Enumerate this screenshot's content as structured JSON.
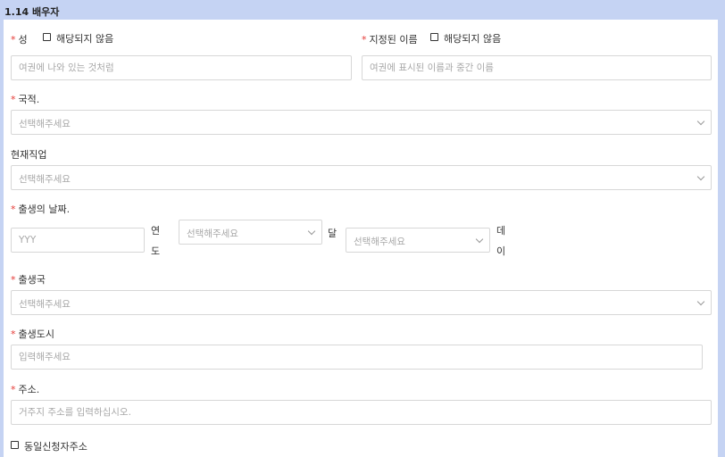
{
  "section": {
    "title": "1.14 배우자"
  },
  "required_mark": "*",
  "surname": {
    "label": "성",
    "not_applicable": "해당되지 않음",
    "placeholder": "여권에 나와 있는 것처럼"
  },
  "given_name": {
    "label": "지정된 이름",
    "not_applicable": "해당되지 않음",
    "placeholder": "여권에 표시된 이름과 중간 이름"
  },
  "nationality": {
    "label": "국적.",
    "placeholder": "선택해주세요"
  },
  "occupation": {
    "label": "현재직업",
    "placeholder": "선택해주세요"
  },
  "birth_date": {
    "label": "출생의 날짜.",
    "year_placeholder": "YYY",
    "year_unit_1": "연",
    "year_unit_2": "도",
    "month_placeholder": "선택해주세요",
    "month_unit": "달",
    "day_placeholder": "선택해주세요",
    "day_unit_1": "데",
    "day_unit_2": "이"
  },
  "birth_country": {
    "label": "출생국",
    "placeholder": "선택해주세요"
  },
  "birth_city": {
    "label": "출생도시",
    "placeholder": "입력해주세요"
  },
  "address": {
    "label": "주소.",
    "placeholder": "거주지 주소를 입력하십시오."
  },
  "same_address": {
    "label": "동일신청자주소"
  }
}
